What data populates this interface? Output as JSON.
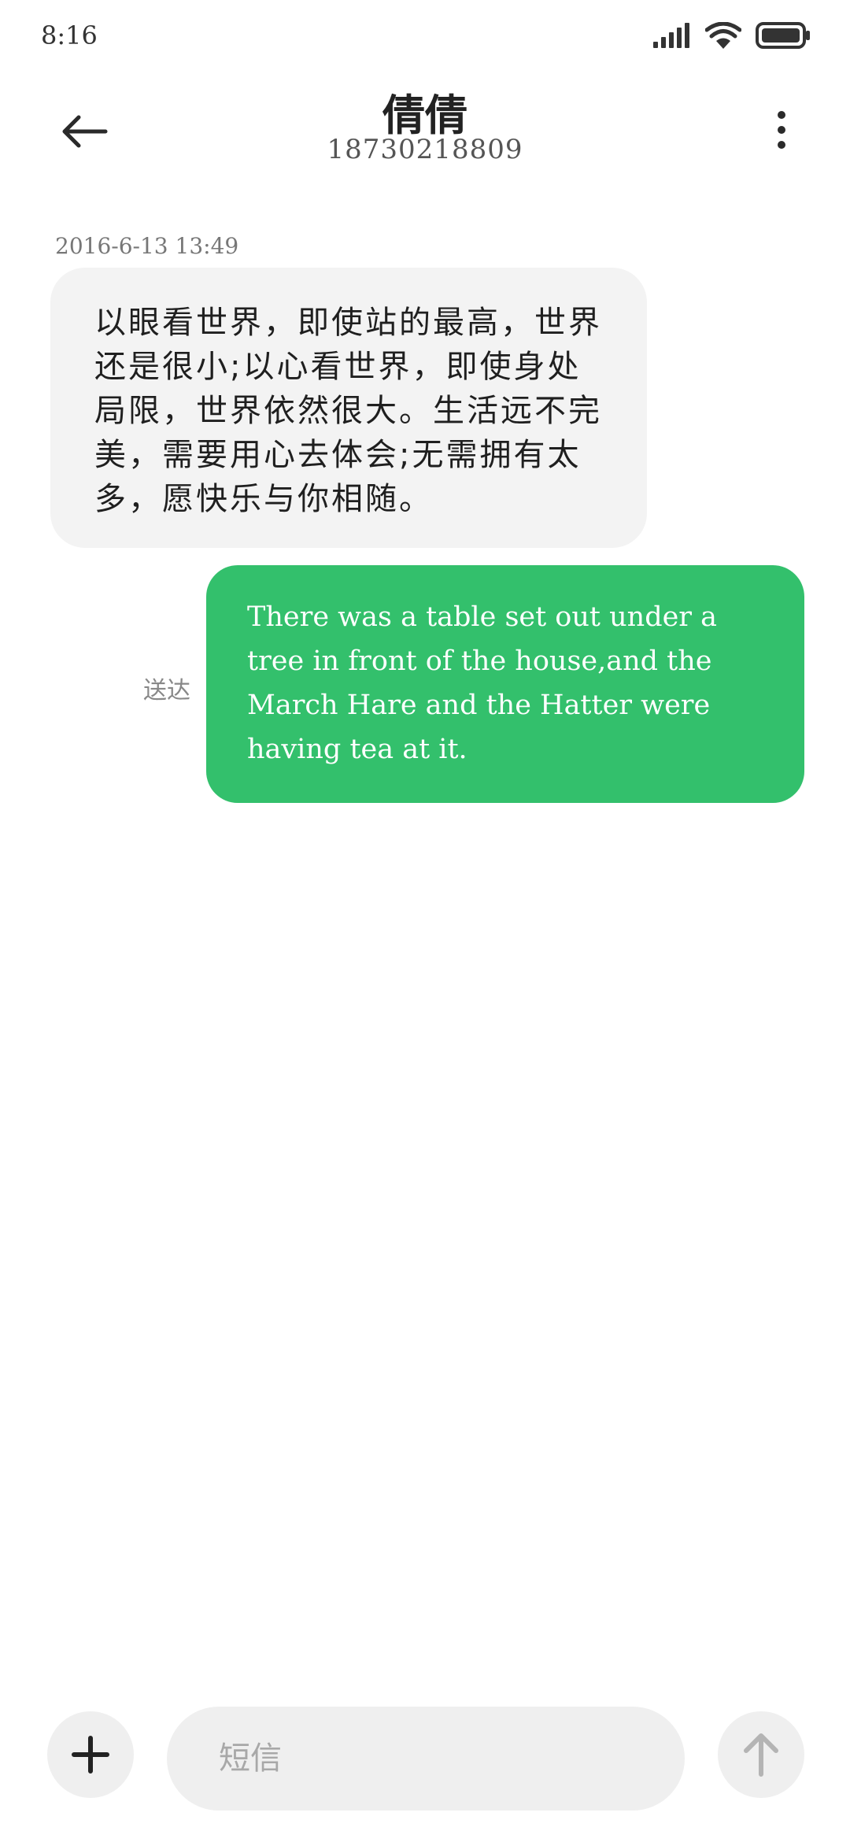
{
  "status_bar": {
    "time": "8:16",
    "icons": [
      "signal-icon",
      "wifi-icon",
      "battery-icon"
    ]
  },
  "header": {
    "back_icon": "arrow-left-icon",
    "contact_name": "倩倩",
    "phone_number": "18730218809",
    "more_icon": "more-vertical-icon"
  },
  "messages": [
    {
      "direction": "incoming",
      "timestamp": "2016-6-13 13:49",
      "text": "以眼看世界，即使站的最高，世界还是很小;以心看世界，即使身处局限，世界依然很大。生活远不完美，需要用心去体会;无需拥有太多，愿快乐与你相随。"
    },
    {
      "direction": "outgoing",
      "status": "送达",
      "text": "There was a table set out under a tree in front of the house,and the March Hare and the Hatter were having tea at it."
    }
  ],
  "composer": {
    "add_icon": "plus-icon",
    "placeholder": "短信",
    "send_icon": "arrow-up-icon"
  },
  "colors": {
    "outgoing_bubble": "#33c06c",
    "incoming_bubble": "#f3f3f3",
    "composer_bg": "#efefef"
  }
}
